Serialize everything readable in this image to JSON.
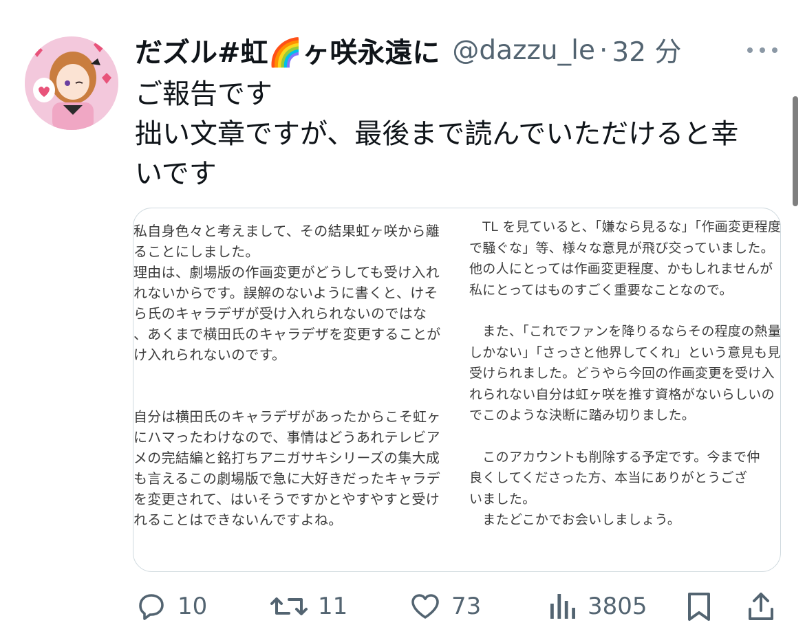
{
  "tweet": {
    "display_name": "だズル#虹🌈ヶ咲永遠に",
    "handle": "@dazzu_le",
    "separator": "·",
    "time": "32 分",
    "text_lines": [
      "ご報告です",
      "拙い文章ですが、最後まで読んでいただけると幸",
      "いです"
    ]
  },
  "media": {
    "left_lines": [
      "私自身色々と考えまして、その結果虹ヶ咲から離",
      "ることにしました。",
      "理由は、劇場版の作画変更がどうしても受け入れ",
      "れないからです。誤解のないように書くと、けそ",
      "ら氏のキャラデザが受け入れられないのではな",
      "、あくまで横田氏のキャラデザを変更することが",
      "け入れられないのです。",
      "",
      "自分は横田氏のキャラデザがあったからこそ虹ヶ",
      "にハマったわけなので、事情はどうあれテレビア",
      "メの完結編と銘打ちアニガサキシリーズの集大成",
      "も言えるこの劇場版で急に大好きだったキャラデ",
      "を変更されて、はいそうですかとやすやすと受け",
      "れることはできないんですよね。"
    ],
    "right_lines": [
      "　TL を見ていると、「嫌なら見るな」「作画変更程度",
      "で騒ぐな」等、様々な意見が飛び交っていました。",
      "他の人にとっては作画変更程度、かもしれませんが",
      "私にとってはものすごく重要なことなので。",
      "",
      "　また、「これでファンを降りるならその程度の熱量",
      "しかない」「さっさと他界してくれ」という意見も見",
      "受けられました。どうやら今回の作画変更を受け入",
      "れられない自分は虹ヶ咲を推す資格がないらしいの",
      "でこのような決断に踏み切りました。",
      "",
      "　このアカウントも削除する予定です。今まで仲",
      "良くしてくださった方、本当にありがとうござ",
      "いました。",
      "　またどこかでお会いしましょう。"
    ]
  },
  "actions": {
    "replies": "10",
    "retweets": "11",
    "likes": "73",
    "views": "3805"
  },
  "icons": {
    "reply": "reply-icon",
    "retweet": "retweet-icon",
    "like": "heart-icon",
    "views": "views-icon",
    "bookmark": "bookmark-icon",
    "share": "share-icon",
    "more": "more-icon"
  },
  "colors": {
    "text": "#0f1419",
    "secondary": "#536471",
    "border": "#cfd9de"
  }
}
